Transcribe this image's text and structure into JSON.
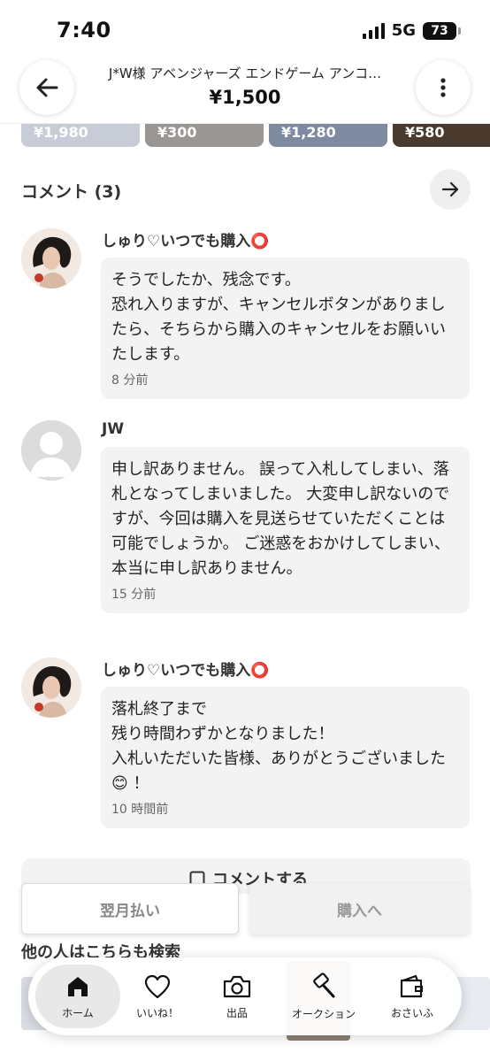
{
  "status_bar": {
    "time": "7:40",
    "network": "5G",
    "battery": "73"
  },
  "header": {
    "title": "J*W様 アベンジャーズ エンドゲーム アンコ…",
    "price": "¥1,500"
  },
  "thumbnails": [
    {
      "price": "¥1,980",
      "color": "#c8ccd6"
    },
    {
      "price": "¥300",
      "color": "#9a9693"
    },
    {
      "price": "¥1,280",
      "color": "#7d8aa0"
    },
    {
      "price": "¥580",
      "color": "#4a3a2e"
    }
  ],
  "comments_section": {
    "title": "コメント (3)",
    "comments": [
      {
        "user": "しゅり♡いつでも購入⭕",
        "text": "そうでしたか、残念です。\n恐れ入りますが、キャンセルボタンがありましたら、そちらから購入のキャンセルをお願いいたします。",
        "time": "8 分前"
      },
      {
        "user": "JW",
        "text": "申し訳ありません。 誤って入札してしまい、落札となってしまいました。 大変申し訳ないのですが、今回は購入を見送らせていただくことは可能でしょうか。 ご迷惑をおかけしてしまい、本当に申し訳ありません。",
        "time": "15 分前"
      },
      {
        "user": "しゅり♡いつでも購入⭕",
        "text": "落札終了まで\n残り時間わずかとなりました！\n入札いただいた皆様、ありがとうございました😊 ！",
        "time": "10 時間前"
      }
    ],
    "comment_button": "コメントする"
  },
  "actions": {
    "left": "翌月払い",
    "right": "購入へ"
  },
  "others": {
    "title": "他の人はこちらも検索"
  },
  "tabbar": {
    "tabs": [
      {
        "label": "ホーム",
        "icon": "home-icon",
        "active": true
      },
      {
        "label": "いいね！",
        "icon": "heart-icon"
      },
      {
        "label": "出品",
        "icon": "camera-icon"
      },
      {
        "label": "オークション",
        "icon": "gavel-icon"
      },
      {
        "label": "おさいふ",
        "icon": "wallet-icon"
      }
    ]
  }
}
